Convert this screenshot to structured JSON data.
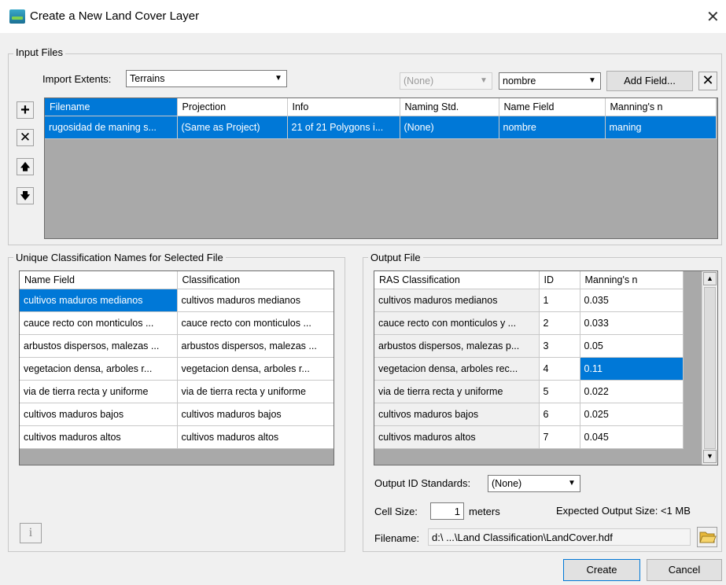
{
  "window": {
    "title": "Create a New Land Cover Layer",
    "close_glyph": "✕"
  },
  "input_files": {
    "legend": "Input Files",
    "import_extents_label": "Import Extents:",
    "import_extents_value": "Terrains",
    "naming_std_value": "(None)",
    "name_field_value": "nombre",
    "add_field_label": "Add Field...",
    "delete_field_glyph": "✕",
    "side_buttons": {
      "add": "+",
      "remove": "✕",
      "up": "🡅",
      "down": "🡇"
    },
    "columns": [
      "Filename",
      "Projection",
      "Info",
      "Naming Std.",
      "Name Field",
      "Manning's n"
    ],
    "rows": [
      [
        "rugosidad de maning s...",
        "(Same as Project)",
        "21 of 21 Polygons i...",
        "(None)",
        "nombre",
        "maning"
      ]
    ]
  },
  "unique_class": {
    "legend": "Unique Classification Names for Selected File",
    "columns": [
      "Name Field",
      "Classification"
    ],
    "rows": [
      [
        "cultivos maduros medianos",
        "cultivos maduros medianos"
      ],
      [
        "cauce recto con monticulos ...",
        "cauce recto con monticulos ..."
      ],
      [
        "arbustos dispersos, malezas ...",
        "arbustos dispersos, malezas ..."
      ],
      [
        "vegetacion densa, arboles r...",
        "vegetacion densa, arboles r..."
      ],
      [
        "via de tierra recta y uniforme",
        "via de tierra recta y uniforme"
      ],
      [
        "cultivos maduros bajos",
        "cultivos maduros bajos"
      ],
      [
        "cultivos maduros altos",
        "cultivos maduros altos"
      ]
    ],
    "info_glyph": "i"
  },
  "output_file": {
    "legend": "Output File",
    "columns": [
      "RAS Classification",
      "ID",
      "Manning's n"
    ],
    "rows": [
      [
        "cultivos maduros medianos",
        "1",
        "0.035"
      ],
      [
        "cauce recto con monticulos y ...",
        "2",
        "0.033"
      ],
      [
        "arbustos dispersos, malezas p...",
        "3",
        "0.05"
      ],
      [
        "vegetacion densa, arboles rec...",
        "4",
        "0.11"
      ],
      [
        "via de tierra recta y uniforme",
        "5",
        "0.022"
      ],
      [
        "cultivos maduros bajos",
        "6",
        "0.025"
      ],
      [
        "cultivos maduros altos",
        "7",
        "0.045"
      ]
    ],
    "id_standards_label": "Output ID Standards:",
    "id_standards_value": "(None)",
    "cell_size_label": "Cell Size:",
    "cell_size_value": "1",
    "cell_size_units": "meters",
    "expected_size": "Expected Output Size: <1 MB",
    "filename_label": "Filename:",
    "filename_value": "d:\\ ...\\Land Classification\\LandCover.hdf"
  },
  "footer": {
    "create_label": "Create",
    "cancel_label": "Cancel"
  },
  "colors": {
    "selection": "#0078d7",
    "grid_bg": "#a9a9a9"
  }
}
